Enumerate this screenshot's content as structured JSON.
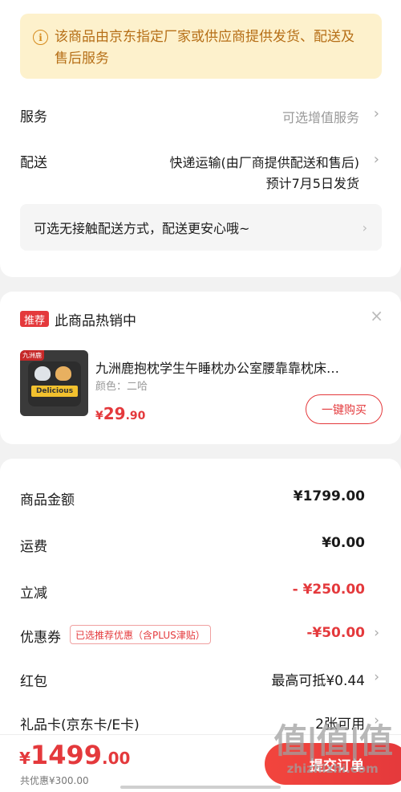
{
  "notice": {
    "icon": "info-icon",
    "text": "该商品由京东指定厂家或供应商提供发货、配送及售后服务"
  },
  "service": {
    "label": "服务",
    "value": "可选增值服务"
  },
  "delivery": {
    "label": "配送",
    "method": "快递运输(由厂商提供配送和售后)",
    "estimate": "预计7月5日发货",
    "contactless": "可选无接触配送方式，配送更安心哦~"
  },
  "recommend": {
    "tag": "推荐",
    "title": "此商品热销中",
    "close": "×",
    "product": {
      "brand_chip": "九洲鹿",
      "image_text": "Delicious",
      "name": "九洲鹿抱枕学生午睡枕办公室腰靠靠枕床…",
      "spec": "颜色：二哈",
      "price_symbol": "¥",
      "price_int": "29",
      "price_dec": ".90",
      "buy_label": "一键购买"
    }
  },
  "summary": {
    "goods_amount": {
      "label": "商品金额",
      "value": "¥1799.00"
    },
    "shipping": {
      "label": "运费",
      "value": "¥0.00"
    },
    "discount": {
      "label": "立减",
      "value": "- ¥250.00"
    },
    "coupon": {
      "label": "优惠券",
      "badge": "已选推荐优惠（含PLUS津贴）",
      "value": "-¥50.00"
    },
    "red_packet": {
      "label": "红包",
      "value": "最高可抵¥0.44"
    },
    "gift_card": {
      "label": "礼品卡(京东卡/E卡)",
      "value": "2张可用"
    }
  },
  "bottom": {
    "total_symbol": "¥",
    "total_int": "1499",
    "total_dec": ".00",
    "saved": "共优惠¥300.00",
    "submit": "提交订单"
  },
  "watermark": {
    "big": "值|值|值",
    "small": "zhizhizhi.com"
  },
  "colors": {
    "accent": "#e4393c",
    "notice_bg": "#fdf1cc",
    "notice_text": "#b66f17"
  }
}
